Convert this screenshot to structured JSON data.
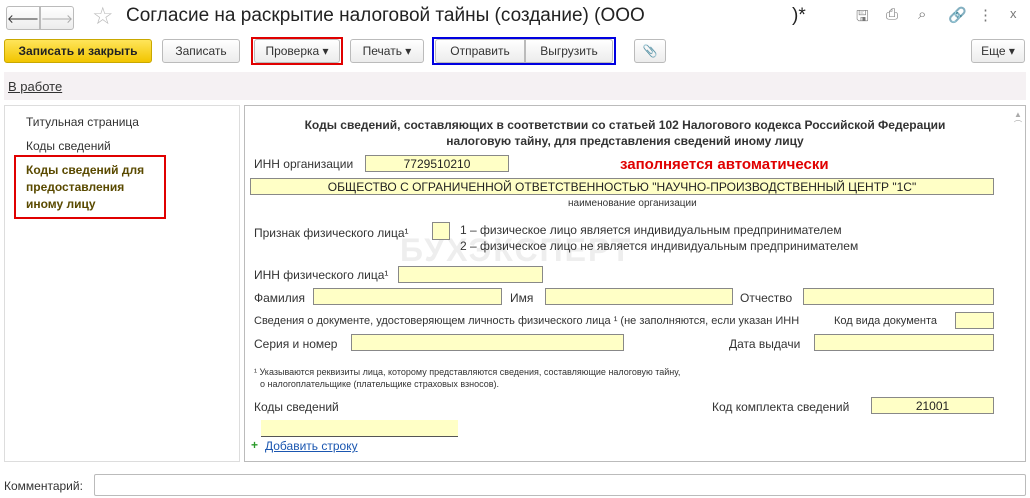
{
  "window": {
    "title": "Согласие на раскрытие налоговой тайны (создание) (ООО",
    "title_suffix": ")*"
  },
  "toolbar": {
    "save_close": "Записать и закрыть",
    "save": "Записать",
    "check": "Проверка",
    "print": "Печать",
    "send": "Отправить",
    "export": "Выгрузить",
    "more": "Еще"
  },
  "status": {
    "link": "В работе"
  },
  "sidebar": {
    "items": [
      {
        "label": "Титульная страница"
      },
      {
        "label": "Коды сведений"
      },
      {
        "label": "Коды сведений для предоставления иному лицу"
      }
    ]
  },
  "form": {
    "heading1": "Коды сведений, составляющих в соответствии со статьей 102 Налогового кодекса Российской Федерации",
    "heading2": "налоговую тайну, для представления сведений иному лицу",
    "inn_org_label": "ИНН организации",
    "inn_org_value": "7729510210",
    "auto_note": "заполняется автоматически",
    "org_name": "ОБЩЕСТВО С ОГРАНИЧЕННОЙ ОТВЕТСТВЕННОСТЬЮ \"НАУЧНО-ПРОИЗВОДСТВЕННЫЙ ЦЕНТР \"1С\"",
    "org_name_caption": "наименование организации",
    "person_sign_label": "Признак физического лица¹",
    "person_sign_opt1": "1 – физическое лицо является индивидуальным предпринимателем",
    "person_sign_opt2": "2 – физическое лицо не является индивидуальным предпринимателем",
    "inn_person_label": "ИНН физического лица¹",
    "surname_label": "Фамилия",
    "name_label": "Имя",
    "patronymic_label": "Отчество",
    "doc_info_label": "Сведения о документе, удостоверяющем личность физического лица ¹ (не заполняются, если указан ИНН",
    "doc_code_label": "Код вида документа",
    "series_label": "Серия и номер",
    "issue_date_label": "Дата выдачи",
    "footnote1": "¹ Указываются реквизиты лица, которому представляются сведения, составляющие налоговую тайну,",
    "footnote2": "о налогоплательщике (плательщике страховых взносов).",
    "codes_label": "Коды сведений",
    "set_code_label": "Код комплекта сведений",
    "set_code_value": "21001",
    "add_row": "Добавить строку",
    "watermark": "БУХЭКСПЕРТ"
  },
  "comment": {
    "label": "Комментарий:",
    "value": ""
  },
  "colors": {
    "accent_red": "#e00000",
    "accent_blue": "#0000e0",
    "field_bg": "#ffffc6"
  }
}
